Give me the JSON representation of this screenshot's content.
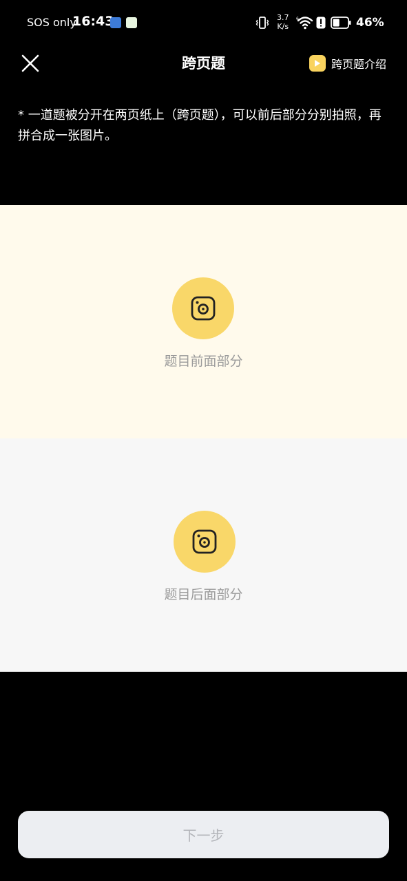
{
  "status_bar": {
    "carrier": "SOS only",
    "time": "16:43",
    "net_speed_value": "3.7",
    "net_speed_unit": "K/s",
    "battery_percent": "46%",
    "battery_level": 0.46,
    "icons": [
      "app-notification-icon",
      "app-notification-icon",
      "vibrate-icon",
      "wifi-icon",
      "alert-icon",
      "battery-icon"
    ]
  },
  "header": {
    "title": "跨页题",
    "close_icon": "close-icon",
    "intro_label": "跨页题介绍",
    "intro_icon": "play-icon"
  },
  "instruction": "* 一道题被分开在两页纸上（跨页题），可以前后部分分别拍照，再拼合成一张图片。",
  "panels": {
    "front": {
      "label": "题目前面部分",
      "icon": "camera-icon"
    },
    "back": {
      "label": "题目后面部分",
      "icon": "camera-icon"
    }
  },
  "footer": {
    "next_label": "下一步"
  },
  "colors": {
    "background": "#000000",
    "accent_yellow": "#f9d769",
    "front_panel_bg": "#fffaec",
    "back_panel_bg": "#f7f7f7",
    "panel_label": "#9b9b9b",
    "next_button_bg": "#eceef2",
    "next_button_text": "#b3b5ba"
  }
}
